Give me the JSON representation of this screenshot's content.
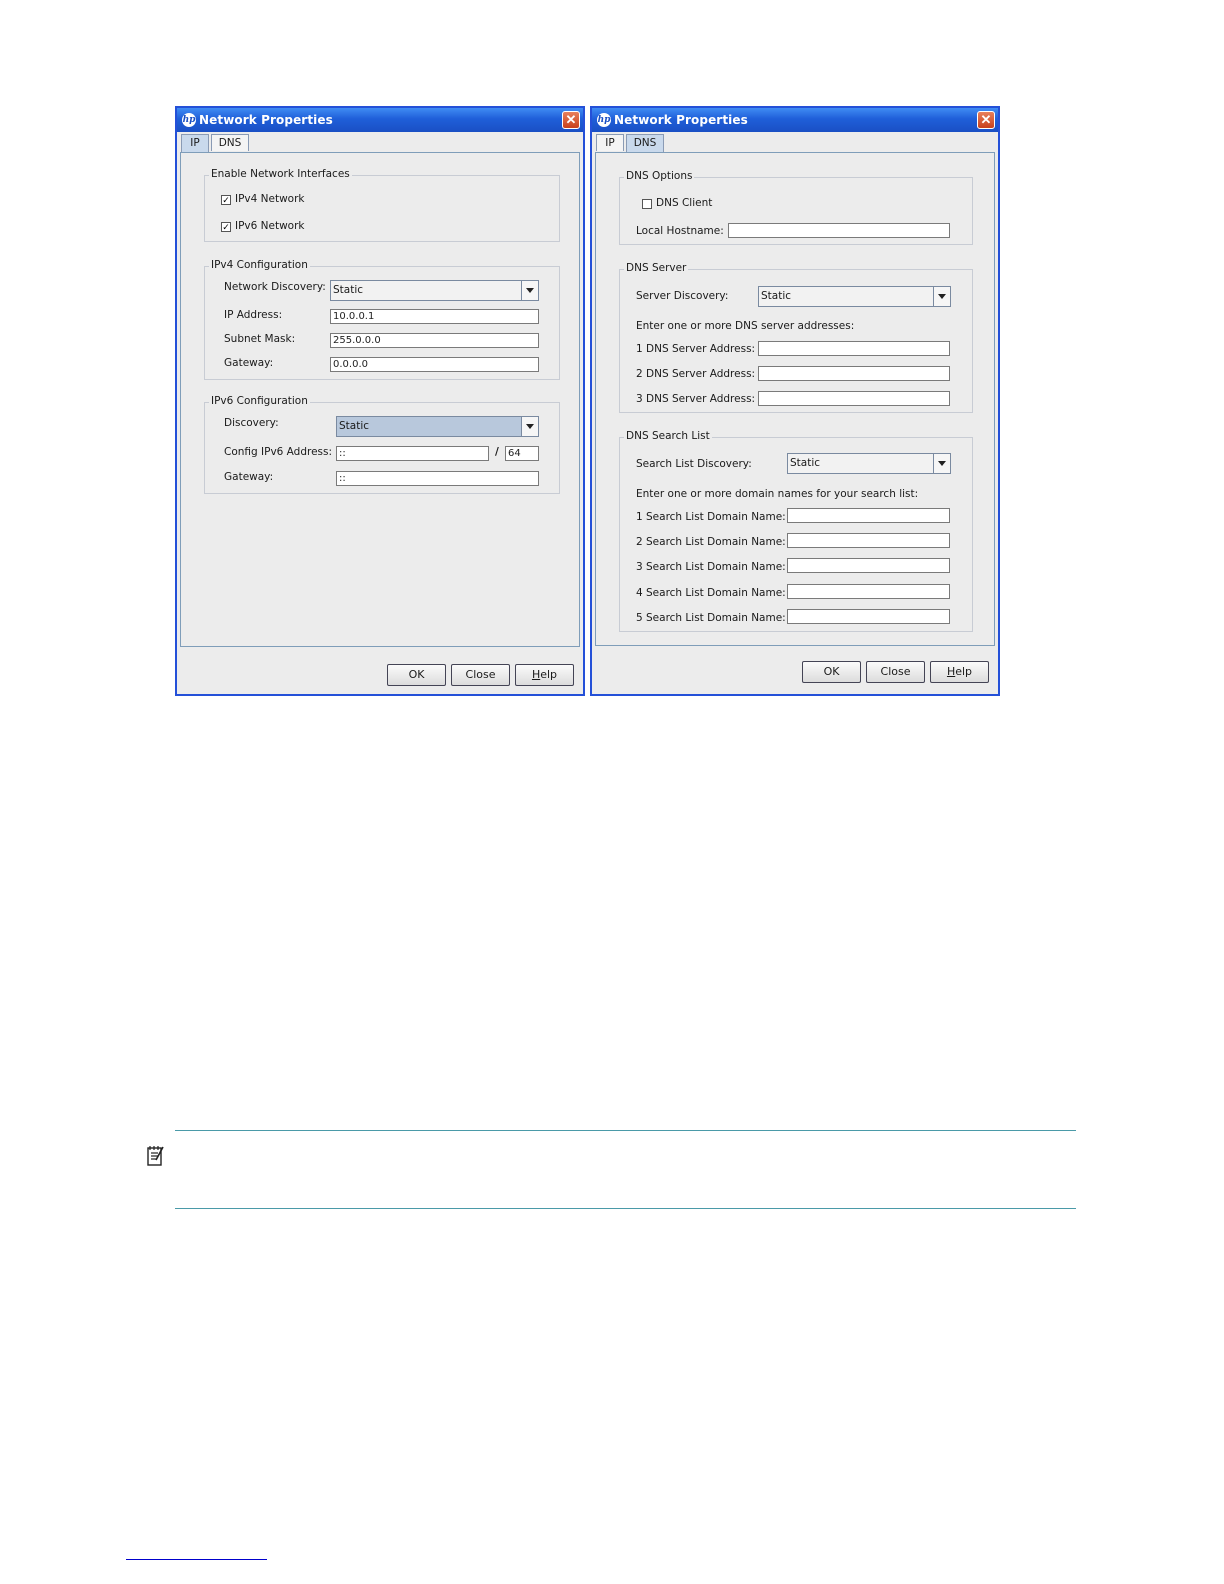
{
  "left_dialog": {
    "title": "Network Properties",
    "tabs": [
      "IP",
      "DNS"
    ],
    "active_tab": "IP",
    "enable_group": {
      "title": "Enable Network Interfaces",
      "ipv4": {
        "label": "IPv4 Network",
        "checked": true
      },
      "ipv6": {
        "label": "IPv6 Network",
        "checked": true
      }
    },
    "ipv4_group": {
      "title": "IPv4 Configuration",
      "discovery_label": "Network Discovery:",
      "discovery_value": "Static",
      "ip_label": "IP Address:",
      "ip_value": "10.0.0.1",
      "mask_label": "Subnet Mask:",
      "mask_value": "255.0.0.0",
      "gateway_label": "Gateway:",
      "gateway_value": "0.0.0.0"
    },
    "ipv6_group": {
      "title": "IPv6 Configuration",
      "discovery_label": "Discovery:",
      "discovery_value": "Static",
      "address_label": "Config IPv6 Address:",
      "address_value": "::",
      "slash": "/",
      "prefix_value": "64",
      "gateway_label": "Gateway:",
      "gateway_value": "::"
    },
    "buttons": {
      "ok": "OK",
      "close": "Close",
      "help_first": "H",
      "help_rest": "elp"
    }
  },
  "right_dialog": {
    "title": "Network Properties",
    "tabs": [
      "IP",
      "DNS"
    ],
    "active_tab": "DNS",
    "options_group": {
      "title": "DNS Options",
      "client_label": "DNS Client",
      "client_checked": false,
      "hostname_label": "Local Hostname:",
      "hostname_value": ""
    },
    "server_group": {
      "title": "DNS Server",
      "discovery_label": "Server Discovery:",
      "discovery_value": "Static",
      "hint": "Enter one or more DNS server addresses:",
      "addresses": [
        {
          "label": "1 DNS Server Address:",
          "value": ""
        },
        {
          "label": "2 DNS Server Address:",
          "value": ""
        },
        {
          "label": "3 DNS Server Address:",
          "value": ""
        }
      ]
    },
    "search_group": {
      "title": "DNS Search List",
      "discovery_label": "Search List Discovery:",
      "discovery_value": "Static",
      "hint": "Enter one or more domain names for your search list:",
      "domains": [
        {
          "label": "1 Search List Domain Name:",
          "value": ""
        },
        {
          "label": "2 Search List Domain Name:",
          "value": ""
        },
        {
          "label": "3 Search List Domain Name:",
          "value": ""
        },
        {
          "label": "4 Search List Domain Name:",
          "value": ""
        },
        {
          "label": "5 Search List Domain Name:",
          "value": ""
        }
      ]
    },
    "buttons": {
      "ok": "OK",
      "close": "Close",
      "help_first": "H",
      "help_rest": "elp"
    }
  },
  "icons": {
    "app_logo": "hp-logo-icon",
    "close": "close-icon",
    "note": "note-icon",
    "dropdown": "chevron-down-icon"
  },
  "colors": {
    "titlebar": "#1f5fd9",
    "note_rule": "#4a9aa8",
    "active_tab": "#c9d9ec"
  }
}
